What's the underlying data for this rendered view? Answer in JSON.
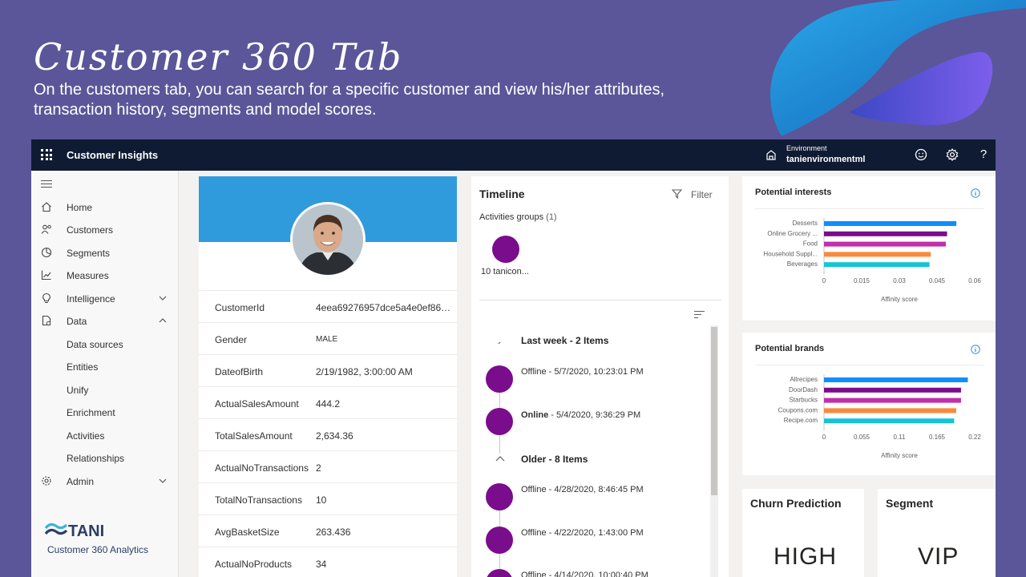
{
  "slide": {
    "title": "Customer 360 Tab",
    "description": "On the customers tab, you can search for a specific customer and view his/her attributes, transaction history, segments and model scores."
  },
  "topbar": {
    "app_name": "Customer Insights",
    "environment_label": "Environment",
    "environment_value": "tanienvironmentml"
  },
  "sidebar": {
    "items": [
      {
        "label": "Home",
        "icon": "home-icon"
      },
      {
        "label": "Customers",
        "icon": "people-icon"
      },
      {
        "label": "Segments",
        "icon": "segments-icon"
      },
      {
        "label": "Measures",
        "icon": "chart-line-icon"
      },
      {
        "label": "Intelligence",
        "icon": "lightbulb-icon"
      },
      {
        "label": "Data",
        "icon": "database-icon"
      },
      {
        "label": "Data sources"
      },
      {
        "label": "Entities"
      },
      {
        "label": "Unify"
      },
      {
        "label": "Enrichment"
      },
      {
        "label": "Activities"
      },
      {
        "label": "Relationships"
      },
      {
        "label": "Admin",
        "icon": "gear-icon"
      }
    ],
    "brand": {
      "logo": "TANI",
      "caption": "Customer 360 Analytics"
    }
  },
  "profile": {
    "attributes": [
      {
        "key": "CustomerId",
        "value": "4eea69276957dce5a4e0ef8646..."
      },
      {
        "key": "Gender",
        "value": "MALE"
      },
      {
        "key": "DateofBirth",
        "value": "2/19/1982, 3:00:00 AM"
      },
      {
        "key": "ActualSalesAmount",
        "value": "444.2"
      },
      {
        "key": "TotalSalesAmount",
        "value": "2,634.36"
      },
      {
        "key": "ActualNoTransactions",
        "value": "2"
      },
      {
        "key": "TotalNoTransactions",
        "value": "10"
      },
      {
        "key": "AvgBasketSize",
        "value": "263.436"
      },
      {
        "key": "ActualNoProducts",
        "value": "34"
      }
    ]
  },
  "timeline": {
    "title": "Timeline",
    "filter_label": "Filter",
    "groups_label": "Activities groups",
    "groups_count": "(1)",
    "group_item_label": "10 tanicon...",
    "sections": [
      {
        "header": "Last week - 2 Items",
        "items": [
          {
            "type": "Offline",
            "date": " - 5/7/2020, 10:23:01 PM"
          },
          {
            "type": "Online",
            "date": " - 5/4/2020, 9:36:29 PM"
          }
        ]
      },
      {
        "header": "Older - 8 Items",
        "items": [
          {
            "type": "Offline",
            "date": " - 4/28/2020, 8:46:45 PM"
          },
          {
            "type": "Offline",
            "date": " - 4/22/2020, 1:43:00 PM"
          },
          {
            "type": "Offline",
            "date": " - 4/14/2020, 10:00:40 PM"
          }
        ]
      }
    ]
  },
  "chart_data": [
    {
      "type": "bar",
      "orientation": "horizontal",
      "title": "Potential interests",
      "categories": [
        "Desserts",
        "Online Grocery ...",
        "Food",
        "Household Suppl...",
        "Beverages"
      ],
      "values": [
        0.0527,
        0.049,
        0.0485,
        0.0425,
        0.042
      ],
      "colors": [
        "#118dff",
        "#7a0d8c",
        "#c12fab",
        "#f98a3c",
        "#15c3d9"
      ],
      "xlabel": "Affinity score",
      "xlim": [
        0,
        0.06
      ],
      "xticks": [
        "0",
        "0.015",
        "0.03",
        "0.045",
        "0.06"
      ]
    },
    {
      "type": "bar",
      "orientation": "horizontal",
      "title": "Potential brands",
      "categories": [
        "Allrecipes",
        "DoorDash",
        "Starbucks",
        "Coupons.com",
        "Recipe.com"
      ],
      "values": [
        0.21,
        0.2,
        0.2,
        0.193,
        0.19
      ],
      "colors": [
        "#118dff",
        "#7a0d8c",
        "#c12fab",
        "#f98a3c",
        "#15c3d9"
      ],
      "xlabel": "Affinity score",
      "xlim": [
        0,
        0.22
      ],
      "xticks": [
        "0",
        "0.055",
        "0.11",
        "0.165",
        "0.22"
      ]
    }
  ],
  "churn": {
    "title": "Churn Prediction",
    "value": "HIGH"
  },
  "segment": {
    "title": "Segment",
    "value": "VIP"
  }
}
